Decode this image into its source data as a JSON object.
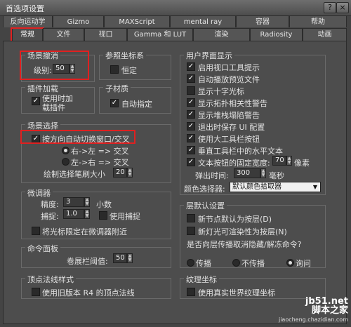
{
  "window": {
    "title": "首选项设置",
    "help_btn": "?",
    "close_btn": "×"
  },
  "tabs_row1": [
    "反向运动学",
    "Gizmo",
    "MAXScript",
    "mental ray",
    "容器",
    "帮助"
  ],
  "tabs_row2": [
    "常规",
    "文件",
    "视口",
    "Gamma 和 LUT",
    "渲染",
    "Radiosity",
    "动画"
  ],
  "scene_undo": {
    "legend": "场景撤消",
    "level_label": "级别:",
    "level_value": "50"
  },
  "ref_coord": {
    "legend": "参照坐标系",
    "constant_label": "恒定"
  },
  "plugin_load": {
    "legend": "插件加载",
    "load_on_use_label": "使用时加载插件"
  },
  "sub_material": {
    "legend": "子材质",
    "auto_assign_label": "自动指定"
  },
  "scene_selection": {
    "legend": "场景选择",
    "auto_window_label": "按方向自动切换窗口/交叉",
    "right_left_label": "右->左 => 交叉",
    "left_right_label": "左->右 => 交叉",
    "brush_size_label": "绘制选择笔刷大小",
    "brush_size_value": "20"
  },
  "spinners": {
    "legend": "微调器",
    "precision_label": "精度:",
    "precision_value": "3",
    "decimal_label": "小数",
    "snap_label": "捕捉:",
    "snap_value": "1.0",
    "use_snap_label": "使用捕捉",
    "wrap_cursor_label": "将光标限定在微调器附近"
  },
  "command_panel": {
    "legend": "命令面板",
    "rollout_label": "卷展栏阈值:",
    "rollout_value": "50"
  },
  "vertex_normal": {
    "legend": "顶点法线样式",
    "r4_label": "使用旧版本 R4 的顶点法线"
  },
  "ui_display": {
    "legend": "用户界面显示",
    "items": [
      "启用视口工具提示",
      "自动播放预览文件",
      "显示十字光标",
      "显示拓扑相关性警告",
      "显示堆栈塌陷警告",
      "退出时保存 UI 配置",
      "使用大工具栏按钮",
      "垂直工具栏中的水平文本",
      "文本按钮的固定宽度:"
    ],
    "checked": [
      true,
      true,
      false,
      true,
      true,
      true,
      true,
      true,
      true
    ],
    "fixed_width_value": "70",
    "pixels_label": "像素",
    "flyout_label": "弹出时间:",
    "flyout_value": "300",
    "ms_label": "毫秒",
    "color_picker_label": "颜色选择器:",
    "color_picker_value": "默认颜色拾取器"
  },
  "layer_defaults": {
    "legend": "层默认设置",
    "new_nodes_label": "新节点默认为按层(D)",
    "new_lights_label": "新灯光可渲染性为按层(N)",
    "propagate_label": "是否向层传播取消隐藏/解冻命令?",
    "radios": [
      "传播",
      "不传播",
      "询问"
    ],
    "selected": 2
  },
  "texture_coords": {
    "legend": "纹理坐标",
    "real_world_label": "使用真实世界纹理坐标"
  },
  "watermark": {
    "line1": "jb51.net",
    "line2": "脚本之家",
    "line3": "jiaocheng.chazidian.com"
  }
}
